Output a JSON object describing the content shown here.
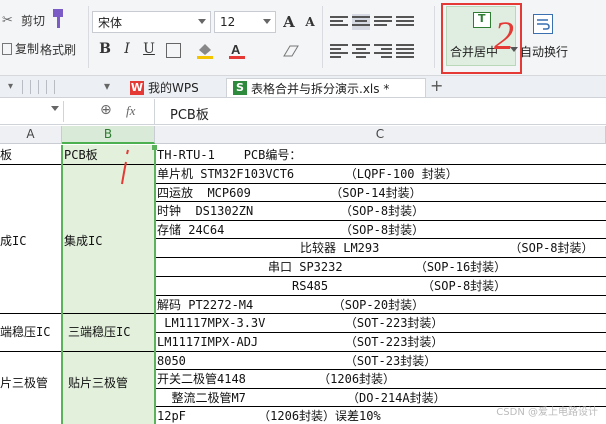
{
  "ribbon": {
    "cut_label": "剪切",
    "copy_label": "复制",
    "format_painter_label": "格式刷",
    "font_name": "宋体",
    "font_size": "12",
    "bold": "B",
    "italic": "I",
    "underline": "U",
    "merge_center_label": "合并居中",
    "wrap_text_label": "自动换行",
    "grow_font": "A",
    "shrink_font": "A"
  },
  "tabs": {
    "wps_label": "我的WPS",
    "file_label": "表格合并与拆分演示.xls *",
    "add_label": "+"
  },
  "formula_bar": {
    "fx": "fx",
    "content": "PCB板"
  },
  "columns": [
    "A",
    "B",
    "C"
  ],
  "cells": {
    "a1": "板",
    "b1": "PCB板",
    "c1": "TH-RTU-1    PCB编号：",
    "a_ic": "成IC",
    "b_ic": "集成IC",
    "a_reg": "端稳压IC",
    "b_reg": "三端稳压IC",
    "a_tri": "片三极管",
    "b_tri": "贴片三极管",
    "c_rows": [
      "单片机 STM32F103VCT6       （LQPF-100 封装）",
      "四运放  MCP609           （SOP-14封装）",
      "时钟  DS1302ZN            （SOP-8封装）",
      "存储 24C64                （SOP-8封装）",
      "比较器 LM293                  （SOP-8封装）",
      "串口 SP3232          （SOP-16封装）",
      "RS485             （SOP-8封装）",
      "解码 PT2272-M4           （SOP-20封装）",
      " LM1117MPX-3.3V           （SOT-223封装）",
      "LM1117IMPX-ADJ            （SOT-223封装）",
      "8050                      （SOT-23封装）",
      "开关二极管4148          （1206封装）",
      "  整流二极管M7              （DO-214A封装）",
      "12pF          （1206封装）误差10%"
    ]
  },
  "annotations": {
    "number_mark": "2"
  },
  "watermark": "CSDN @爱上电路设计"
}
